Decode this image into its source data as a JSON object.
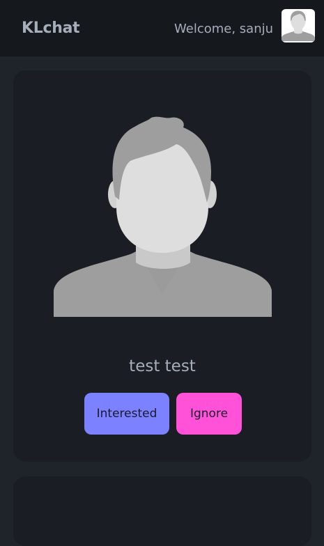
{
  "navbar": {
    "brand": "KLchat",
    "welcome": "Welcome, sanju",
    "avatar_icon": "user-silhouette-icon"
  },
  "profile_card": {
    "photo_icon": "user-silhouette-icon",
    "name": "test test",
    "interested_label": "Interested",
    "ignore_label": "Ignore"
  },
  "colors": {
    "page_bg": "#1f232a",
    "navbar_bg": "#15181c",
    "card_bg": "#1a1d23",
    "text": "#a6adbb",
    "interested": "#7b81ff",
    "ignore": "#ff52d9"
  }
}
